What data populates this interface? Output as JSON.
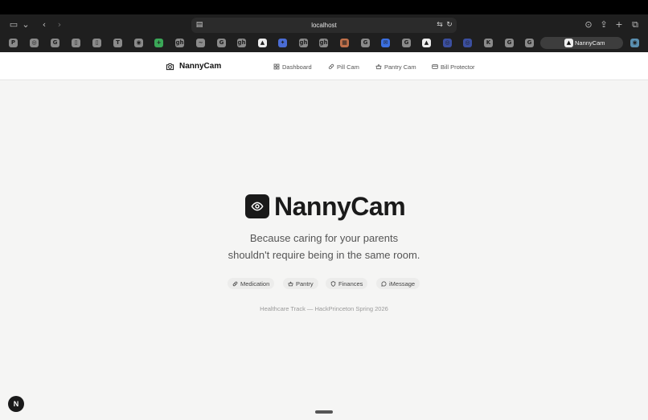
{
  "browser": {
    "url": "localhost",
    "active_tab_label": "NannyCam",
    "toolbar_icons": [
      "sidebar-icon",
      "chevron-down-icon",
      "back-icon",
      "forward-icon",
      "reader-icon",
      "translate-icon",
      "reload-icon",
      "download-icon",
      "share-icon",
      "new-tab-icon",
      "tab-overview-icon"
    ],
    "favorites": [
      "P",
      "◎",
      "G",
      "▯",
      "▯",
      "T",
      "◉",
      "+",
      "gh",
      "~",
      "G",
      "gh",
      "▲",
      "✦",
      "gh",
      "gh",
      "▦",
      "G",
      "✉",
      "G",
      "▲",
      "◎",
      "◎",
      "K",
      "G",
      "G"
    ],
    "extension_icon": "◉"
  },
  "nav": {
    "brand": "NannyCam",
    "links": [
      "Dashboard",
      "Pill Cam",
      "Pantry Cam",
      "Bill Protector"
    ]
  },
  "hero": {
    "title": "NannyCam",
    "tagline_line1": "Because caring for your parents",
    "tagline_line2": "shouldn't require being in the same room.",
    "pills": [
      "Medication",
      "Pantry",
      "Finances",
      "iMessage"
    ],
    "footer": "Healthcare Track — HackPrinceton Spring 2026"
  },
  "dev_badge": "N",
  "colors": {
    "background": "#f5f5f4",
    "brand_dark": "#1a1a1a",
    "chrome": "#1f1f1f"
  }
}
